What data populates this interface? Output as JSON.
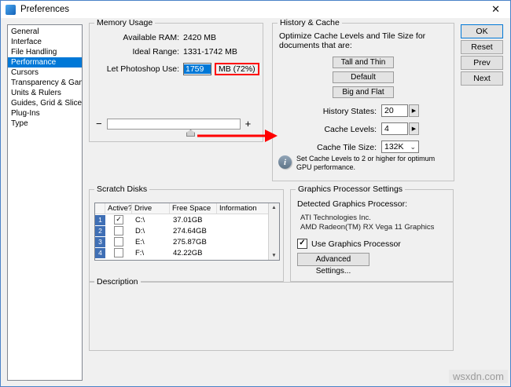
{
  "window": {
    "title": "Preferences"
  },
  "icons": {
    "close": "✕",
    "minus": "−",
    "plus": "+",
    "spinner": "▶",
    "chevron": "⌄",
    "check": "✓",
    "info": "i",
    "up": "▲",
    "down": "▼"
  },
  "sidebar": {
    "items": [
      {
        "label": "General"
      },
      {
        "label": "Interface"
      },
      {
        "label": "File Handling"
      },
      {
        "label": "Performance"
      },
      {
        "label": "Cursors"
      },
      {
        "label": "Transparency & Gamut"
      },
      {
        "label": "Units & Rulers"
      },
      {
        "label": "Guides, Grid & Slices"
      },
      {
        "label": "Plug-Ins"
      },
      {
        "label": "Type"
      }
    ]
  },
  "memory": {
    "title": "Memory Usage",
    "available_ram_label": "Available RAM:",
    "available_ram_value": "2420 MB",
    "ideal_range_label": "Ideal Range:",
    "ideal_range_value": "1331-1742 MB",
    "let_use_label": "Let Photoshop Use:",
    "let_use_value": "1759",
    "let_use_suffix": "MB (72%)",
    "slider_fill_style": "width:62%"
  },
  "history_cache": {
    "title": "History & Cache",
    "optimize_text": "Optimize Cache Levels and Tile Size for documents that are:",
    "buttons": [
      "Tall and Thin",
      "Default",
      "Big and Flat"
    ],
    "history_states_label": "History States:",
    "history_states_value": "20",
    "cache_levels_label": "Cache Levels:",
    "cache_levels_value": "4",
    "cache_tile_label": "Cache Tile Size:",
    "cache_tile_value": "132K",
    "gpu_note": "Set Cache Levels to 2 or higher for optimum GPU performance."
  },
  "scratch": {
    "title": "Scratch Disks",
    "columns": [
      "Active?",
      "Drive",
      "Free Space",
      "Information"
    ],
    "rows": [
      {
        "num": "1",
        "active_glyph": "✓",
        "drive": "C:\\",
        "free": "37.01GB",
        "info": ""
      },
      {
        "num": "2",
        "active_glyph": "",
        "drive": "D:\\",
        "free": "274.64GB",
        "info": ""
      },
      {
        "num": "3",
        "active_glyph": "",
        "drive": "E:\\",
        "free": "275.87GB",
        "info": ""
      },
      {
        "num": "4",
        "active_glyph": "",
        "drive": "F:\\",
        "free": "42.22GB",
        "info": ""
      }
    ]
  },
  "gpu": {
    "title": "Graphics Processor Settings",
    "detected_label": "Detected Graphics Processor:",
    "vendor": "ATI Technologies Inc.",
    "model": "AMD Radeon(TM) RX Vega 11 Graphics",
    "use_gpu_label": "Use Graphics Processor",
    "advanced_button": "Advanced Settings..."
  },
  "description": {
    "title": "Description"
  },
  "action_buttons": {
    "ok": "OK",
    "reset": "Reset",
    "prev": "Prev",
    "next": "Next"
  },
  "watermark": "wsxdn.com",
  "colors": {
    "accent": "#0078d7",
    "selection": "#0078d7",
    "annotation_red": "#ff0000",
    "slider_fill": "#1473e6"
  }
}
